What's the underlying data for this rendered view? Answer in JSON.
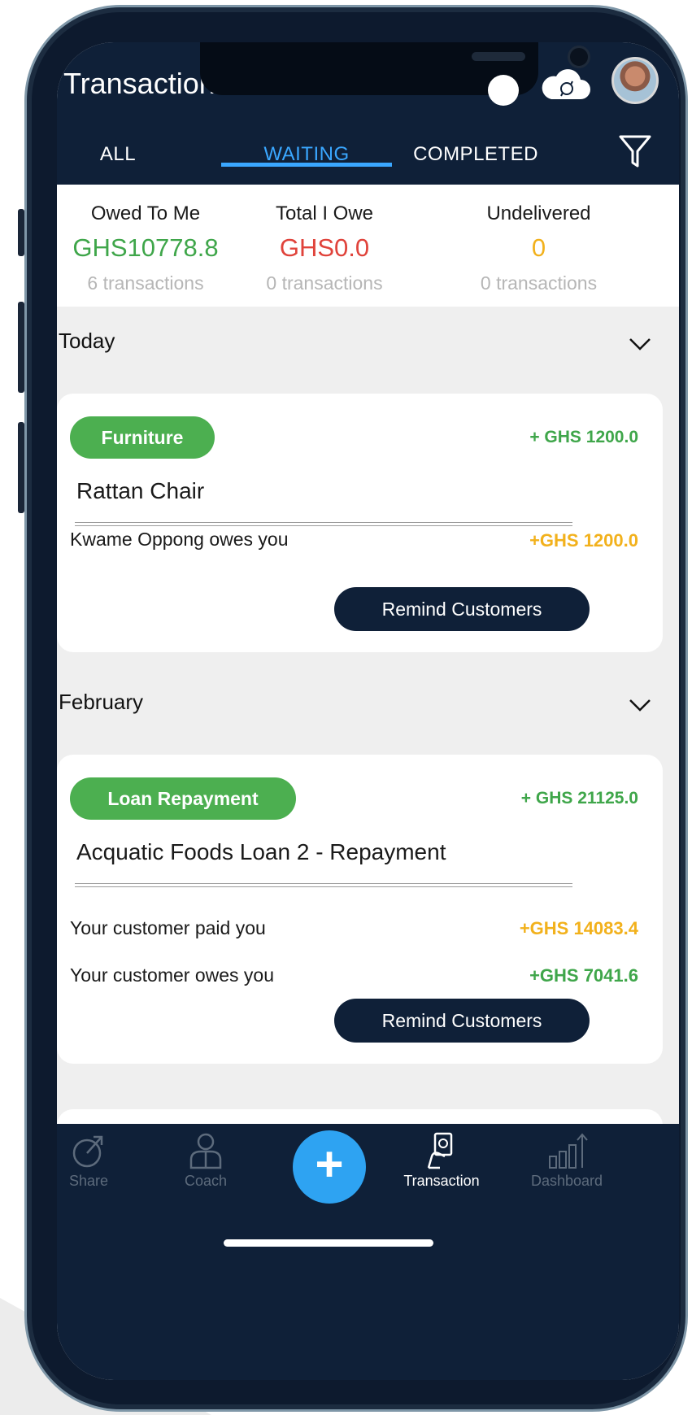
{
  "header": {
    "title": "Transactions",
    "avatar_icon": "user-avatar",
    "sync_icon": "cloud-sync-icon"
  },
  "tabs": [
    {
      "label": "ALL",
      "active": false
    },
    {
      "label": "WAITING",
      "active": true
    },
    {
      "label": "COMPLETED",
      "active": false
    }
  ],
  "summary": [
    {
      "label": "Owed To Me",
      "value": "GHS10778.8",
      "count": "6 transactions",
      "color": "#3fa64a"
    },
    {
      "label": "Total I Owe",
      "value": "GHS0.0",
      "count": "0 transactions",
      "color": "#e0433b"
    },
    {
      "label": "Undelivered",
      "value": "0",
      "count": "0 transactions",
      "color": "#f2b11c"
    }
  ],
  "sections": [
    {
      "title": "Today",
      "card": {
        "category": "Furniture",
        "amount": "+ GHS 1200.0",
        "name": "Rattan Chair",
        "rows": [
          {
            "text": "Kwame Oppong owes you",
            "amount": "+GHS 1200.0"
          }
        ],
        "button": "Remind Customers"
      }
    },
    {
      "title": "February",
      "card": {
        "category": "Loan Repayment",
        "amount": "+ GHS 21125.0",
        "name": "Acquatic Foods Loan 2 - Repayment",
        "rows": [
          {
            "text": "Your customer paid you",
            "amount": "+GHS 14083.4"
          },
          {
            "text": "Your customer owes you",
            "amount": "+GHS 7041.6"
          }
        ],
        "button": "Remind Customers"
      }
    }
  ],
  "nav": {
    "share": "Share",
    "coach": "Coach",
    "add": "+",
    "transaction": "Transaction",
    "dashboard": "Dashboard"
  },
  "colors": {
    "navy": "#0f2038",
    "accent": "#3aa7ff",
    "green": "#4caf50",
    "yellow": "#f2b11c",
    "red": "#e0433b"
  }
}
